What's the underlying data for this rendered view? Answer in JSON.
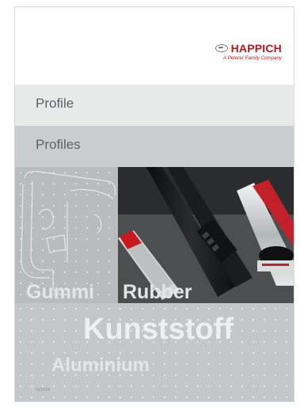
{
  "brand": {
    "name": "HAPPICH",
    "tagline": "A Peterer Family Company",
    "logo_icon": "happich-logo-icon",
    "color": "#c4121a"
  },
  "titles": {
    "german": "Profile",
    "english": "Profiles"
  },
  "materials": {
    "gummi": "Gummi",
    "rubber": "Rubber",
    "kunststoff": "Kunststoff",
    "aluminium": "Aluminium"
  },
  "doc_code": "03/2018"
}
